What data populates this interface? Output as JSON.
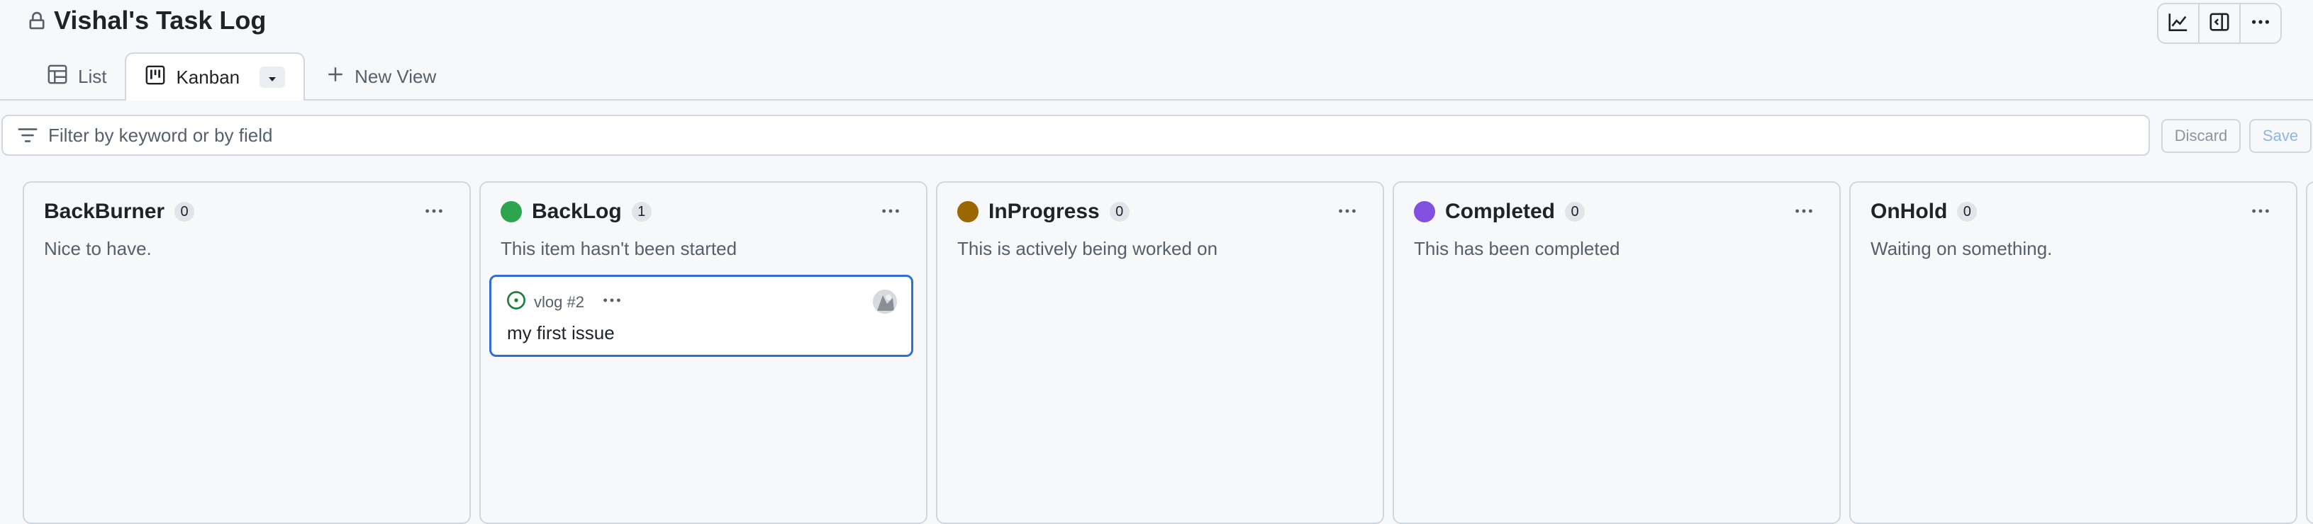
{
  "header": {
    "title": "Vishal's Task Log",
    "actions": [
      {
        "icon": "graph-icon"
      },
      {
        "icon": "sidebar-panel-icon"
      },
      {
        "icon": "kebab-menu-icon"
      }
    ]
  },
  "tabs": [
    {
      "label": "List",
      "icon": "table-icon",
      "active": false
    },
    {
      "label": "Kanban",
      "icon": "board-icon",
      "active": true
    },
    {
      "label": "New View",
      "icon": "plus-icon",
      "active": false
    }
  ],
  "filter": {
    "placeholder": "Filter by keyword or by field",
    "discard_label": "Discard",
    "save_label": "Save"
  },
  "columns": [
    {
      "name": "BackBurner",
      "count": "0",
      "description": "Nice to have.",
      "color": null
    },
    {
      "name": "BackLog",
      "count": "1",
      "description": "This item hasn't been started",
      "color": "#2da44e",
      "cards": [
        {
          "id": "vlog #2",
          "title": "my first issue"
        }
      ]
    },
    {
      "name": "InProgress",
      "count": "0",
      "description": "This is actively being worked on",
      "color": "#9a6700"
    },
    {
      "name": "Completed",
      "count": "0",
      "description": "This has been completed",
      "color": "#8250df"
    },
    {
      "name": "OnHold",
      "count": "0",
      "description": "Waiting on something.",
      "color": null
    }
  ],
  "colors": {
    "accent": "#2f6fd6",
    "open_issue": "#1a7f37"
  }
}
